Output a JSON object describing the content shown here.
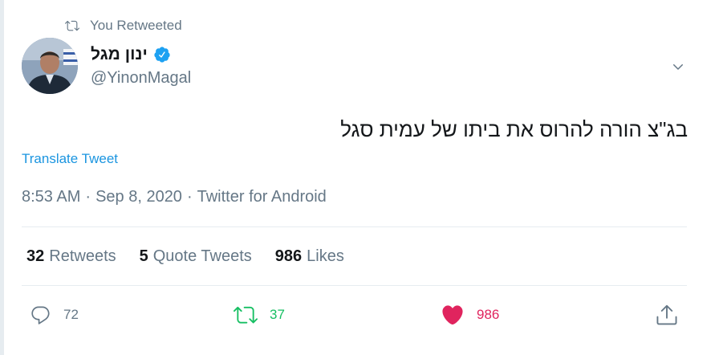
{
  "retweet_context": {
    "label": "You Retweeted",
    "icon": "retweet-icon"
  },
  "author": {
    "display_name": "ינון מגל",
    "handle": "@YinonMagal",
    "verified": true,
    "avatar_icon": "avatar-photo"
  },
  "tweet": {
    "text": "בג\"צ הורה להרוס את ביתו של עמית סגל",
    "translate_label": "Translate Tweet",
    "time": "8:53 AM",
    "date": "Sep 8, 2020",
    "separator": "·",
    "source": "Twitter for Android"
  },
  "stats": {
    "retweets_count": "32",
    "retweets_label": "Retweets",
    "quote_count": "5",
    "quote_label": "Quote Tweets",
    "likes_count": "986",
    "likes_label": "Likes"
  },
  "actions": {
    "reply_count": "72",
    "retweet_count": "37",
    "like_count": "986"
  },
  "colors": {
    "link": "#1b95e0",
    "secondary_text": "#657786",
    "retweet_green": "#17bf63",
    "like_red": "#e0245e",
    "divider": "#e6ecf0"
  }
}
